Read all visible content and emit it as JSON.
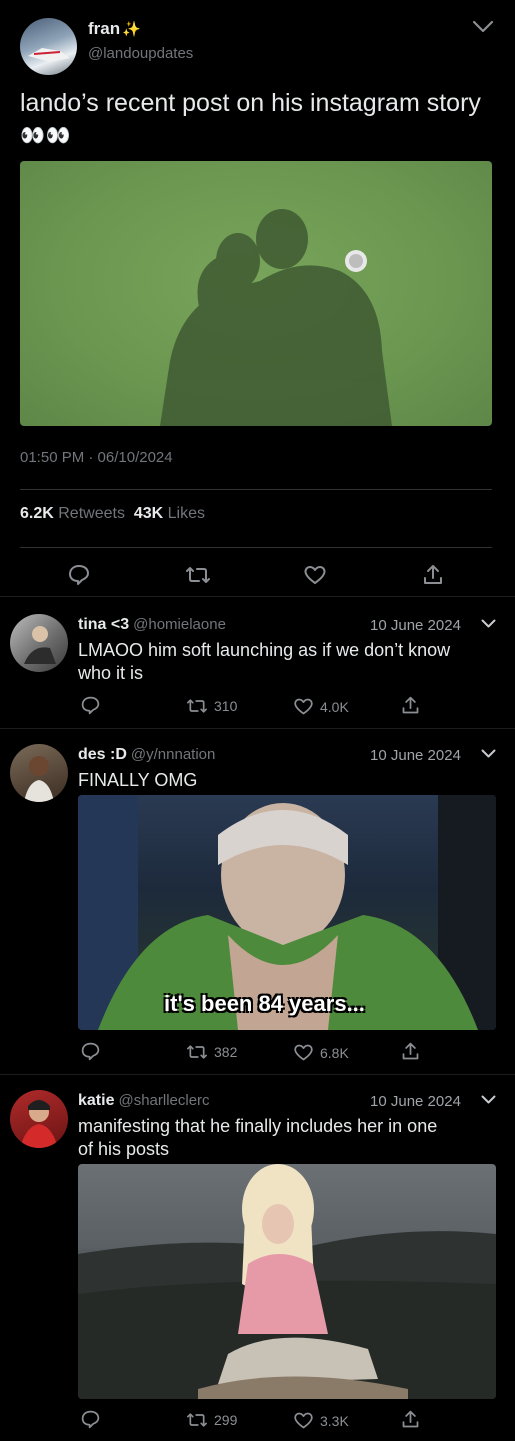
{
  "tweet": {
    "display_name": "fran",
    "sparkle": "✨",
    "handle": "@landoupdates",
    "text": "lando’s recent post on his instagram story",
    "emoji": "👀👀",
    "timestamp": "01:50 PM · 06/10/2024",
    "retweets_count": "6.2K",
    "retweets_label": "Retweets",
    "likes_count": "43K",
    "likes_label": "Likes"
  },
  "replies": [
    {
      "name": "tina <3",
      "handle": "@homielaone",
      "date": "10 June 2024",
      "text_line1": "LMAOO him soft launching as if we don’t know",
      "text_line2": "who it is",
      "retweets": "310",
      "likes": "4.0K"
    },
    {
      "name": "des :D",
      "handle": "@y/nnnation",
      "date": "10 June 2024",
      "text_line1": "FINALLY OMG",
      "media_caption": "it's been 84 years...",
      "retweets": "382",
      "likes": "6.8K"
    },
    {
      "name": "katie",
      "handle": "@sharlleclerc",
      "date": "10 June 2024",
      "text_line1": "manifesting that he finally includes her in one",
      "text_line2": "of his posts",
      "retweets": "299",
      "likes": "3.3K"
    }
  ],
  "colors": {
    "background": "#000000",
    "text": "#e7e9ea",
    "muted": "#71767b",
    "divider": "#2f3336",
    "sparkle": "#f5c84c"
  },
  "icons": [
    "chevron-down-icon",
    "reply-icon",
    "retweet-icon",
    "like-icon",
    "share-icon"
  ]
}
